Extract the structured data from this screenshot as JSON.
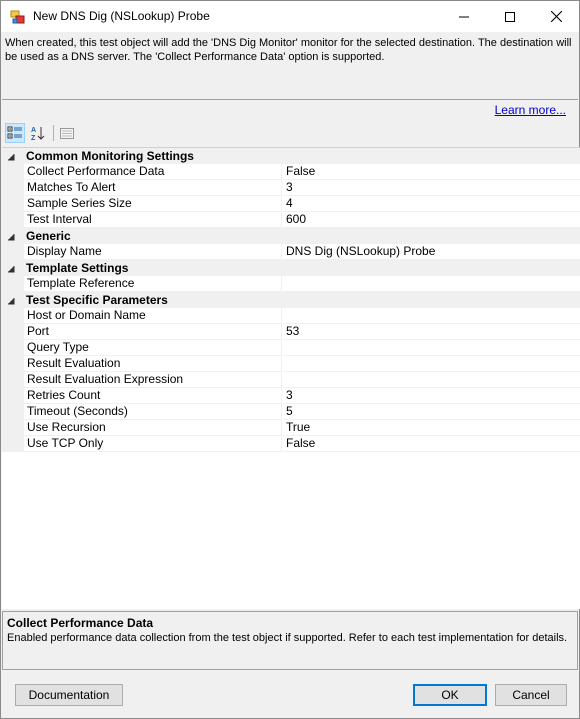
{
  "window": {
    "title": "New DNS Dig (NSLookup) Probe"
  },
  "description": "When created, this test object will add the 'DNS Dig Monitor' monitor for the selected destination. The destination will be used as a DNS server. The 'Collect Performance Data' option is supported.",
  "links": {
    "learn_more": "Learn more..."
  },
  "toolbar": {
    "categorized_icon": "categorized-view-icon",
    "alphabetical_icon": "sort-az-icon",
    "property_pages_icon": "property-pages-icon"
  },
  "grid": {
    "categories": [
      {
        "name": "Common Monitoring Settings",
        "properties": [
          {
            "name": "Collect Performance Data",
            "value": "False"
          },
          {
            "name": "Matches To Alert",
            "value": "3"
          },
          {
            "name": "Sample Series Size",
            "value": "4"
          },
          {
            "name": "Test Interval",
            "value": "600"
          }
        ]
      },
      {
        "name": "Generic",
        "properties": [
          {
            "name": "Display Name",
            "value": "DNS Dig (NSLookup) Probe"
          }
        ]
      },
      {
        "name": "Template Settings",
        "properties": [
          {
            "name": "Template Reference",
            "value": ""
          }
        ]
      },
      {
        "name": "Test Specific Parameters",
        "properties": [
          {
            "name": "Host or Domain Name",
            "value": ""
          },
          {
            "name": "Port",
            "value": "53"
          },
          {
            "name": "Query Type",
            "value": ""
          },
          {
            "name": "Result Evaluation",
            "value": ""
          },
          {
            "name": "Result Evaluation Expression",
            "value": ""
          },
          {
            "name": "Retries Count",
            "value": "3"
          },
          {
            "name": "Timeout (Seconds)",
            "value": "5"
          },
          {
            "name": "Use Recursion",
            "value": "True"
          },
          {
            "name": "Use TCP Only",
            "value": "False"
          }
        ]
      }
    ]
  },
  "help": {
    "title": "Collect Performance Data",
    "text": "Enabled performance data collection from the test object if supported. Refer to each test implementation for details."
  },
  "buttons": {
    "documentation": "Documentation",
    "ok": "OK",
    "cancel": "Cancel"
  },
  "colors": {
    "link": "#0000cc",
    "accent": "#0078d7",
    "panel": "#f0f0f0"
  }
}
